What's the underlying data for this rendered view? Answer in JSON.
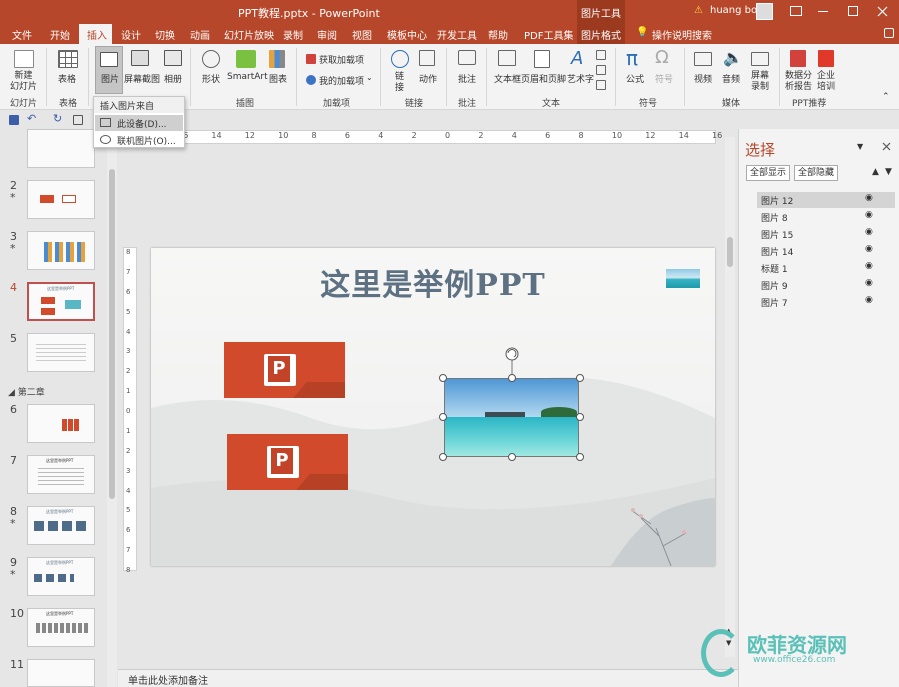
{
  "titlebar": {
    "filename": "PPT教程.pptx",
    "separator": "-",
    "app": "PowerPoint",
    "context": "图片工具",
    "user": "huang bo",
    "warning": "⚠"
  },
  "tabs": [
    "文件",
    "开始",
    "插入",
    "设计",
    "切换",
    "动画",
    "幻灯片放映",
    "录制",
    "审阅",
    "视图",
    "模板中心",
    "开发工具",
    "帮助",
    "PDF工具集",
    "图片格式",
    "操作说明搜索"
  ],
  "ribbon": {
    "new_slide": [
      "新建",
      "幻灯片"
    ],
    "table": "表格",
    "picture": "图片",
    "screenshot": "屏幕截图",
    "album": "相册",
    "shapes": "形状",
    "smartart": "SmartArt",
    "chart": "图表",
    "get_addins": "获取加载项",
    "my_addins": "我的加载项",
    "link": [
      "链",
      "接"
    ],
    "action": "动作",
    "comment": "批注",
    "textbox": "文本框",
    "header_footer": "页眉和页脚",
    "wordart": "艺术字",
    "equation": "公式",
    "symbol": "符号",
    "video": "视频",
    "audio": "音频",
    "screen_record": [
      "屏幕",
      "录制"
    ],
    "data_analysis": [
      "数据分",
      "析报告"
    ],
    "training": [
      "企业",
      "培训"
    ],
    "groups": [
      "幻灯片",
      "表格",
      "插图",
      "加载项",
      "链接",
      "批注",
      "文本",
      "符号",
      "媒体",
      "PPT推荐"
    ]
  },
  "dropdown": {
    "header": "插入图片来自",
    "items": [
      "此设备(D)...",
      "联机图片(O)..."
    ]
  },
  "thumbnails": {
    "numbers": [
      "2",
      "3",
      "4",
      "5",
      "6",
      "7",
      "8",
      "9",
      "10",
      "11"
    ],
    "section": "第二章",
    "slide_title": "这里是举例PPT",
    "star": "*"
  },
  "ruler": {
    "h": [
      "16",
      "14",
      "12",
      "10",
      "8",
      "6",
      "4",
      "2",
      "0",
      "2",
      "4",
      "6",
      "8",
      "10",
      "12",
      "14",
      "16"
    ],
    "v": [
      "8",
      "7",
      "6",
      "5",
      "4",
      "3",
      "2",
      "1",
      "0",
      "1",
      "2",
      "3",
      "4",
      "5",
      "6",
      "7",
      "8"
    ]
  },
  "slide": {
    "title": "这里是举例PPT",
    "ppt_icon": "P"
  },
  "selection_pane": {
    "title": "选择",
    "show_all": "全部显示",
    "hide_all": "全部隐藏",
    "items": [
      "图片 12",
      "图片 8",
      "图片 15",
      "图片 14",
      "标题 1",
      "图片 9",
      "图片 7"
    ]
  },
  "notes": "单击此处添加备注",
  "watermark": {
    "name": "欧菲资源网",
    "url": "www.office26.com"
  },
  "colors": {
    "accent": "#b7472a",
    "ppt_tile": "#d04a2b",
    "title_text": "#5d7182"
  }
}
